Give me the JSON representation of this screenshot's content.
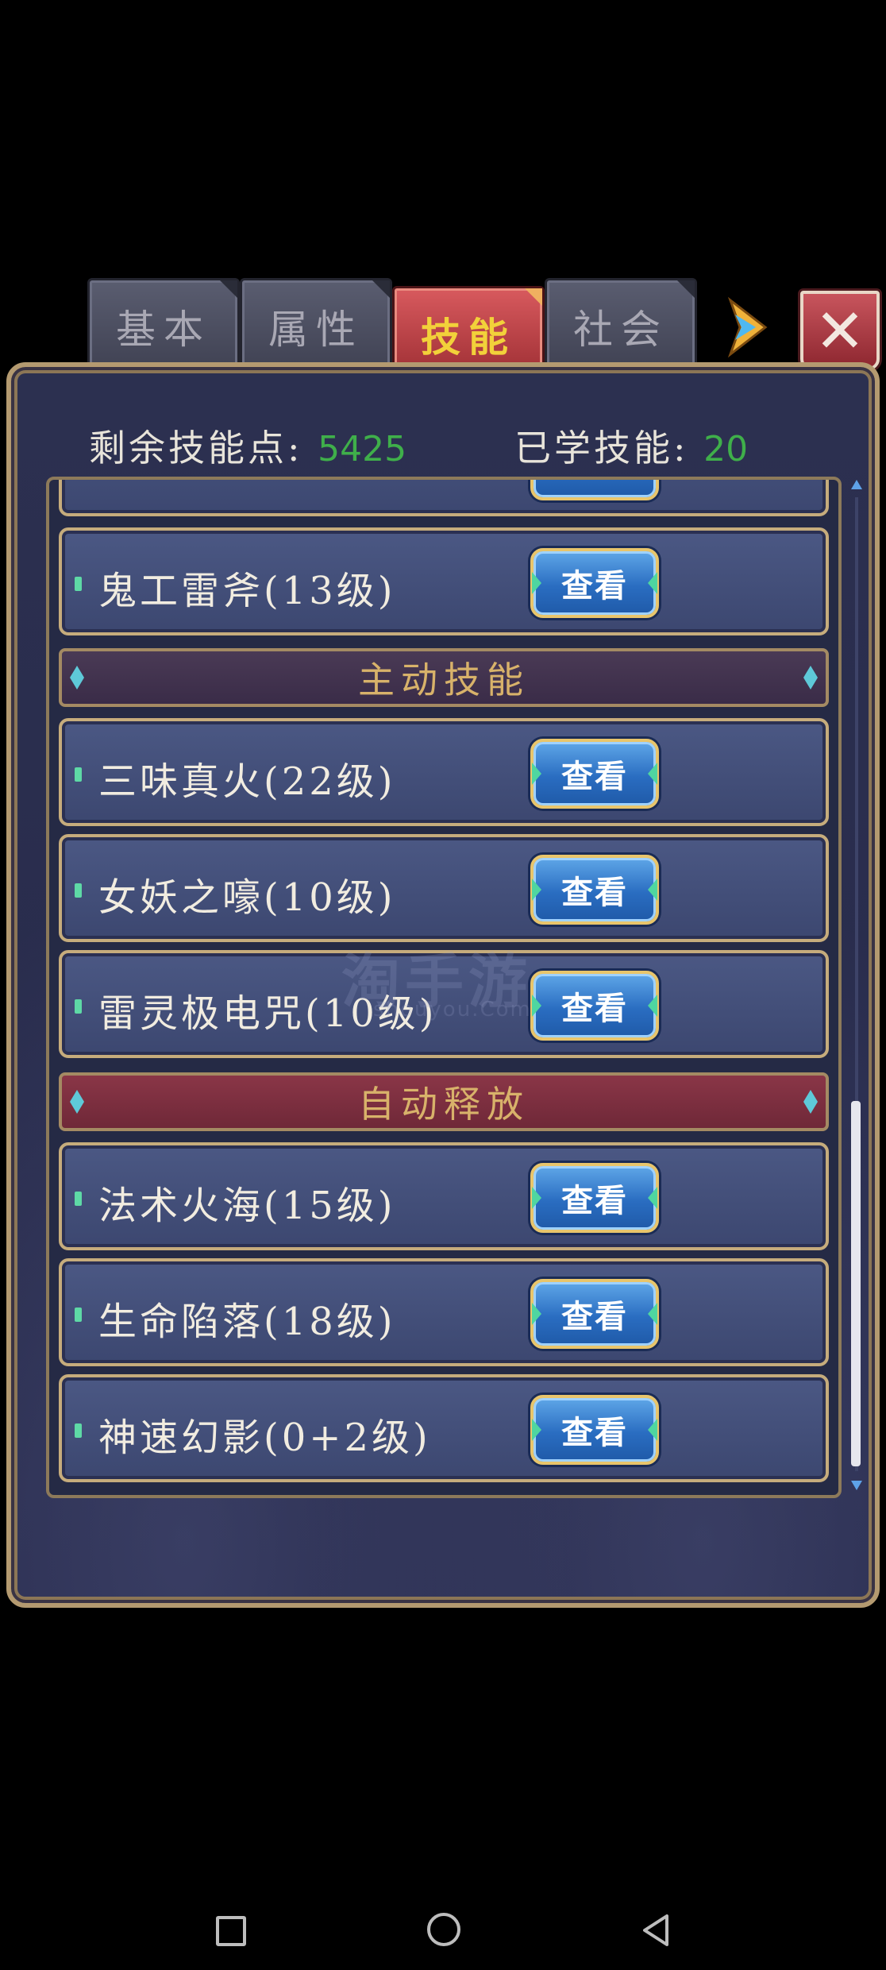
{
  "tabs": [
    {
      "label": "基本",
      "active": false
    },
    {
      "label": "属性",
      "active": false
    },
    {
      "label": "技能",
      "active": true
    },
    {
      "label": "社会",
      "active": false
    }
  ],
  "close_icon": "✕",
  "stats": {
    "remaining_label": "剩余技能点:",
    "remaining_value": "5425",
    "learned_label": "已学技能:",
    "learned_value": "20"
  },
  "view_label": "查看",
  "skills_top": [
    {
      "name": "鬼工雷斧(13级)"
    }
  ],
  "sections": {
    "active": "主动技能",
    "auto": "自动释放"
  },
  "skills_active": [
    {
      "name": "三味真火(22级)"
    },
    {
      "name": "女妖之嚎(10级)"
    },
    {
      "name": "雷灵极电咒(10级)"
    }
  ],
  "skills_auto": [
    {
      "name": "法术火海(15级)"
    },
    {
      "name": "生命陷落(18级)"
    },
    {
      "name": "神速幻影(0+2级)"
    }
  ],
  "watermark": {
    "main": "淘手游",
    "sub": "shouyou.Com"
  },
  "colors": {
    "accent_red": "#b8383f",
    "value_green": "#3faf4a",
    "button_blue": "#2a6dc1",
    "frame_gold": "#c6ac7c"
  },
  "icons": {
    "next": "arrow-right-icon",
    "close": "close-icon",
    "nav_recent": "square-icon",
    "nav_home": "circle-icon",
    "nav_back": "triangle-back-icon"
  }
}
